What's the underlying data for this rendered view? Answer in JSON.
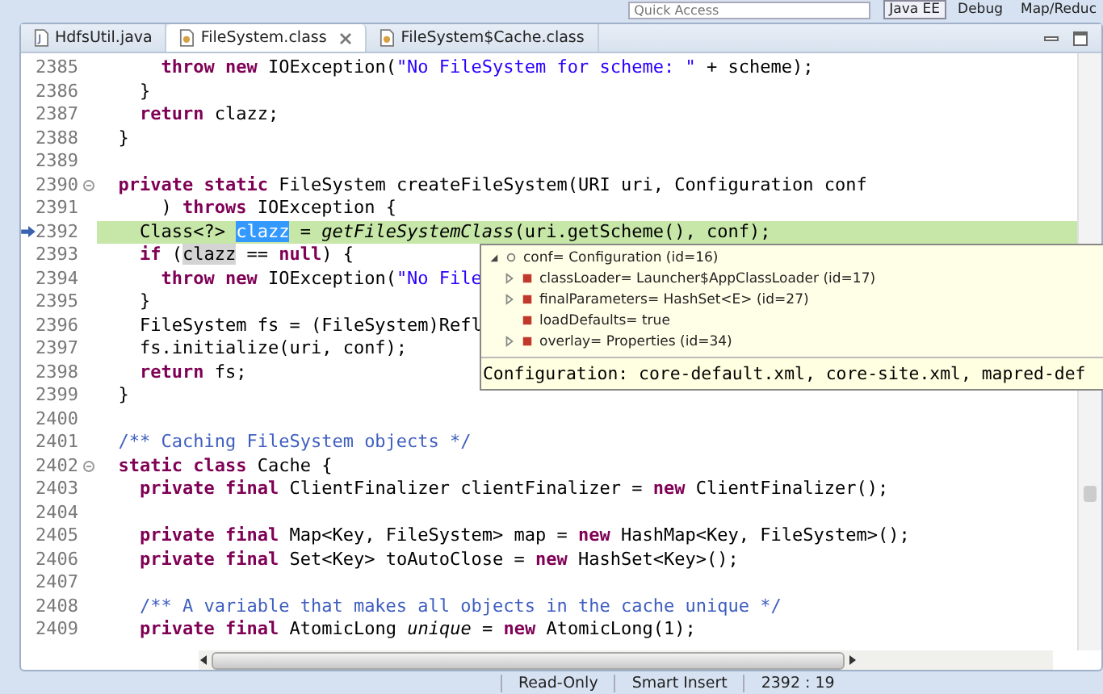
{
  "toolbar": {
    "quick_access": {
      "placeholder": "Quick Access"
    },
    "perspectives": [
      {
        "label": "Java EE",
        "selected": true
      },
      {
        "label": "Debug",
        "selected": false
      },
      {
        "label": "Map/Reduc",
        "selected": false
      }
    ]
  },
  "tabs": [
    {
      "label": "HdfsUtil.java",
      "kind": "java",
      "selected": false,
      "closable": false
    },
    {
      "label": "FileSystem.class",
      "kind": "class",
      "selected": true,
      "closable": true
    },
    {
      "label": "FileSystem$Cache.class",
      "kind": "class",
      "selected": false,
      "closable": false
    }
  ],
  "editor": {
    "lines": [
      {
        "number": "2385",
        "current": false,
        "fold": false,
        "tokens": [
          {
            "t": "      throw new",
            "kind": "keyword"
          },
          {
            "t": " IOException(",
            "kind": "plain"
          },
          {
            "t": "\"No FileSystem for scheme: \"",
            "kind": "string"
          },
          {
            "t": " + scheme);",
            "kind": "plain"
          }
        ]
      },
      {
        "number": "2386",
        "current": false,
        "fold": false,
        "tokens": [
          {
            "t": "    }",
            "kind": "plain"
          }
        ]
      },
      {
        "number": "2387",
        "current": false,
        "fold": false,
        "tokens": [
          {
            "t": "    return",
            "kind": "keyword"
          },
          {
            "t": " clazz;",
            "kind": "plain"
          }
        ]
      },
      {
        "number": "2388",
        "current": false,
        "fold": false,
        "tokens": [
          {
            "t": "  }",
            "kind": "plain"
          }
        ]
      },
      {
        "number": "2389",
        "current": false,
        "fold": false
      },
      {
        "number": "2390",
        "current": false,
        "fold": true,
        "tokens": [
          {
            "t": "  private static",
            "kind": "keyword"
          },
          {
            "t": " FileSystem createFileSystem(URI uri, Configuration conf",
            "kind": "plain"
          }
        ]
      },
      {
        "number": "2391",
        "current": false,
        "fold": false,
        "tokens": [
          {
            "t": "      ) ",
            "kind": "plain"
          },
          {
            "t": "throws",
            "kind": "keyword"
          },
          {
            "t": " IOException {",
            "kind": "plain"
          }
        ]
      },
      {
        "number": "2392",
        "current": true,
        "fold": false,
        "tokens": [
          {
            "t": "    Class<?> ",
            "kind": "plain"
          },
          {
            "t": "clazz",
            "kind": "selected"
          },
          {
            "t": " = ",
            "kind": "plain"
          },
          {
            "t": "getFileSystemClass",
            "kind": "italic"
          },
          {
            "t": "(uri.getScheme(), conf);",
            "kind": "plain"
          }
        ]
      },
      {
        "number": "2393",
        "current": false,
        "fold": false,
        "tokens": [
          {
            "t": "    if",
            "kind": "keyword"
          },
          {
            "t": " (",
            "kind": "plain"
          },
          {
            "t": "clazz",
            "kind": "occurrence"
          },
          {
            "t": " == ",
            "kind": "plain"
          },
          {
            "t": "null",
            "kind": "keyword"
          },
          {
            "t": ") {",
            "kind": "plain"
          }
        ]
      },
      {
        "number": "2394",
        "current": false,
        "fold": false,
        "tokens": [
          {
            "t": "      throw new",
            "kind": "keyword"
          },
          {
            "t": " IOException(",
            "kind": "plain"
          },
          {
            "t": "\"No File",
            "kind": "string"
          }
        ]
      },
      {
        "number": "2395",
        "current": false,
        "fold": false,
        "tokens": [
          {
            "t": "    }",
            "kind": "plain"
          }
        ]
      },
      {
        "number": "2396",
        "current": false,
        "fold": false,
        "tokens": [
          {
            "t": "    FileSystem fs = (FileSystem)Refl",
            "kind": "plain"
          }
        ]
      },
      {
        "number": "2397",
        "current": false,
        "fold": false,
        "tokens": [
          {
            "t": "    fs.initialize(uri, conf);",
            "kind": "plain"
          }
        ]
      },
      {
        "number": "2398",
        "current": false,
        "fold": false,
        "tokens": [
          {
            "t": "    return",
            "kind": "keyword"
          },
          {
            "t": " fs;",
            "kind": "plain"
          }
        ]
      },
      {
        "number": "2399",
        "current": false,
        "fold": false,
        "tokens": [
          {
            "t": "  }",
            "kind": "plain"
          }
        ]
      },
      {
        "number": "2400",
        "current": false,
        "fold": false
      },
      {
        "number": "2401",
        "current": false,
        "fold": false,
        "tokens": [
          {
            "t": "  /** Caching FileSystem objects */",
            "kind": "comment"
          }
        ]
      },
      {
        "number": "2402",
        "current": false,
        "fold": true,
        "tokens": [
          {
            "t": "  static class",
            "kind": "keyword"
          },
          {
            "t": " Cache {",
            "kind": "plain"
          }
        ]
      },
      {
        "number": "2403",
        "current": false,
        "fold": false,
        "tokens": [
          {
            "t": "    private final",
            "kind": "keyword"
          },
          {
            "t": " ClientFinalizer clientFinalizer = ",
            "kind": "plain"
          },
          {
            "t": "new",
            "kind": "keyword"
          },
          {
            "t": " ClientFinalizer();",
            "kind": "plain"
          }
        ]
      },
      {
        "number": "2404",
        "current": false,
        "fold": false
      },
      {
        "number": "2405",
        "current": false,
        "fold": false,
        "tokens": [
          {
            "t": "    private final",
            "kind": "keyword"
          },
          {
            "t": " Map<Key, FileSystem> map = ",
            "kind": "plain"
          },
          {
            "t": "new",
            "kind": "keyword"
          },
          {
            "t": " HashMap<Key, FileSystem>();",
            "kind": "plain"
          }
        ]
      },
      {
        "number": "2406",
        "current": false,
        "fold": false,
        "tokens": [
          {
            "t": "    private final",
            "kind": "keyword"
          },
          {
            "t": " Set<Key> toAutoClose = ",
            "kind": "plain"
          },
          {
            "t": "new",
            "kind": "keyword"
          },
          {
            "t": " HashSet<Key>();",
            "kind": "plain"
          }
        ]
      },
      {
        "number": "2407",
        "current": false,
        "fold": false
      },
      {
        "number": "2408",
        "current": false,
        "fold": false,
        "tokens": [
          {
            "t": "    /** A variable that makes all objects in the cache unique */",
            "kind": "comment"
          }
        ]
      },
      {
        "number": "2409",
        "current": false,
        "fold": false,
        "tokens": [
          {
            "t": "    private final",
            "kind": "keyword"
          },
          {
            "t": " AtomicLong ",
            "kind": "plain"
          },
          {
            "t": "unique",
            "kind": "italic"
          },
          {
            "t": " = ",
            "kind": "plain"
          },
          {
            "t": "new",
            "kind": "keyword"
          },
          {
            "t": " AtomicLong(1);",
            "kind": "plain"
          }
        ]
      }
    ]
  },
  "hover": {
    "root": {
      "label": "conf= Configuration  (id=16)",
      "expanded": true
    },
    "children": [
      {
        "label": "classLoader= Launcher$AppClassLoader  (id=17)",
        "expandable": true
      },
      {
        "label": "finalParameters= HashSet<E>  (id=27)",
        "expandable": true
      },
      {
        "label": "loadDefaults= true",
        "expandable": false
      },
      {
        "label": "overlay= Properties  (id=34)",
        "expandable": true
      }
    ],
    "detail": "Configuration: core-default.xml, core-site.xml, mapred-def"
  },
  "status_bar": [
    "Read-Only",
    "Smart Insert",
    "2392 : 19"
  ]
}
